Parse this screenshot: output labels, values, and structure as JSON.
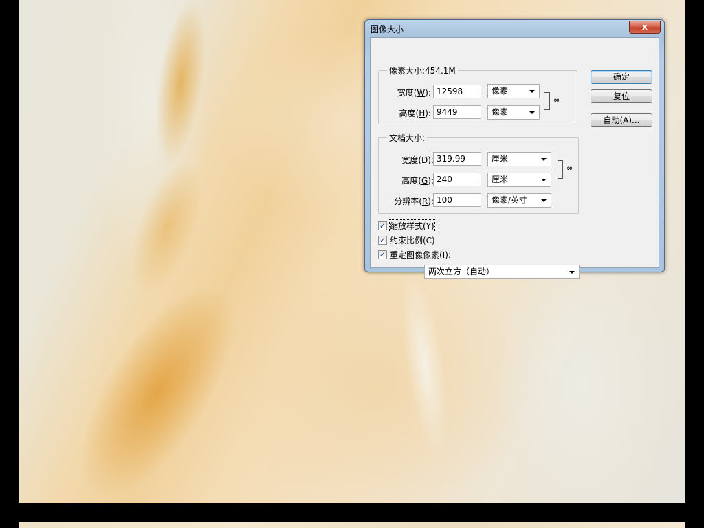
{
  "dialog": {
    "title": "图像大小",
    "close_label": "x",
    "buttons": {
      "ok": "确定",
      "reset": "复位",
      "auto": "自动(A)..."
    },
    "pixel_dimensions": {
      "legend": "像素大小:454.1M",
      "width_label": "宽度(W):",
      "width_value": "12598",
      "width_unit": "像素",
      "height_label": "高度(H):",
      "height_value": "9449",
      "height_unit": "像素"
    },
    "document_size": {
      "legend": "文档大小:",
      "width_label": "宽度(D):",
      "width_value": "319.99",
      "width_unit": "厘米",
      "height_label": "高度(G):",
      "height_value": "240",
      "height_unit": "厘米",
      "resolution_label": "分辨率(R):",
      "resolution_value": "100",
      "resolution_unit": "像素/英寸"
    },
    "options": {
      "scale_styles": {
        "label": "缩放样式(Y)",
        "checked": true
      },
      "constrain_proportions": {
        "label": "约束比例(C)",
        "checked": true
      },
      "resample_image": {
        "label": "重定图像像素(I):",
        "checked": true
      },
      "resample_method": "两次立方（自动）"
    }
  },
  "icons": {
    "link": "chain-link-icon",
    "check": "checkmark-icon",
    "dropdown": "chevron-down-icon"
  }
}
